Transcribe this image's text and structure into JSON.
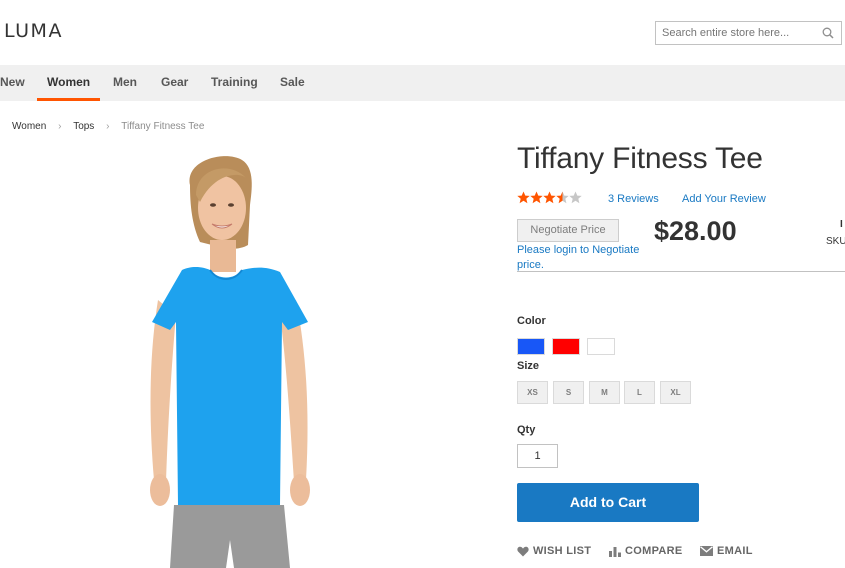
{
  "header": {
    "logo_text": "LUMA",
    "search_placeholder": "Search entire store here..."
  },
  "nav": {
    "items": [
      "New",
      "Women",
      "Men",
      "Gear",
      "Training",
      "Sale"
    ],
    "active": "Women"
  },
  "breadcrumb": [
    "Women",
    "Tops",
    "Tiffany Fitness Tee"
  ],
  "product": {
    "title": "Tiffany Fitness Tee",
    "rating_stars": 3.5,
    "rating_max": 5,
    "reviews_label": "3 Reviews",
    "add_review_label": "Add Your Review",
    "negotiate_button": "Negotiate Price",
    "negotiate_note": "Please login to Negotiate price.",
    "price": "$28.00",
    "stock_label": "I",
    "sku_label": "SKU",
    "color_label": "Color",
    "colors": [
      {
        "name": "Blue",
        "hex": "#1857f7"
      },
      {
        "name": "Red",
        "hex": "#ff0000"
      },
      {
        "name": "White",
        "hex": "#ffffff"
      }
    ],
    "size_label": "Size",
    "sizes": [
      "XS",
      "S",
      "M",
      "L",
      "XL"
    ],
    "qty_label": "Qty",
    "qty_value": "1",
    "add_to_cart_label": "Add to Cart",
    "actions": [
      "WISH LIST",
      "COMPARE",
      "EMAIL"
    ]
  },
  "colors": {
    "accent": "#1979c3",
    "nav_active_underline": "#ff5501",
    "star": "#ff5501",
    "tee": "#1ea2ee"
  }
}
